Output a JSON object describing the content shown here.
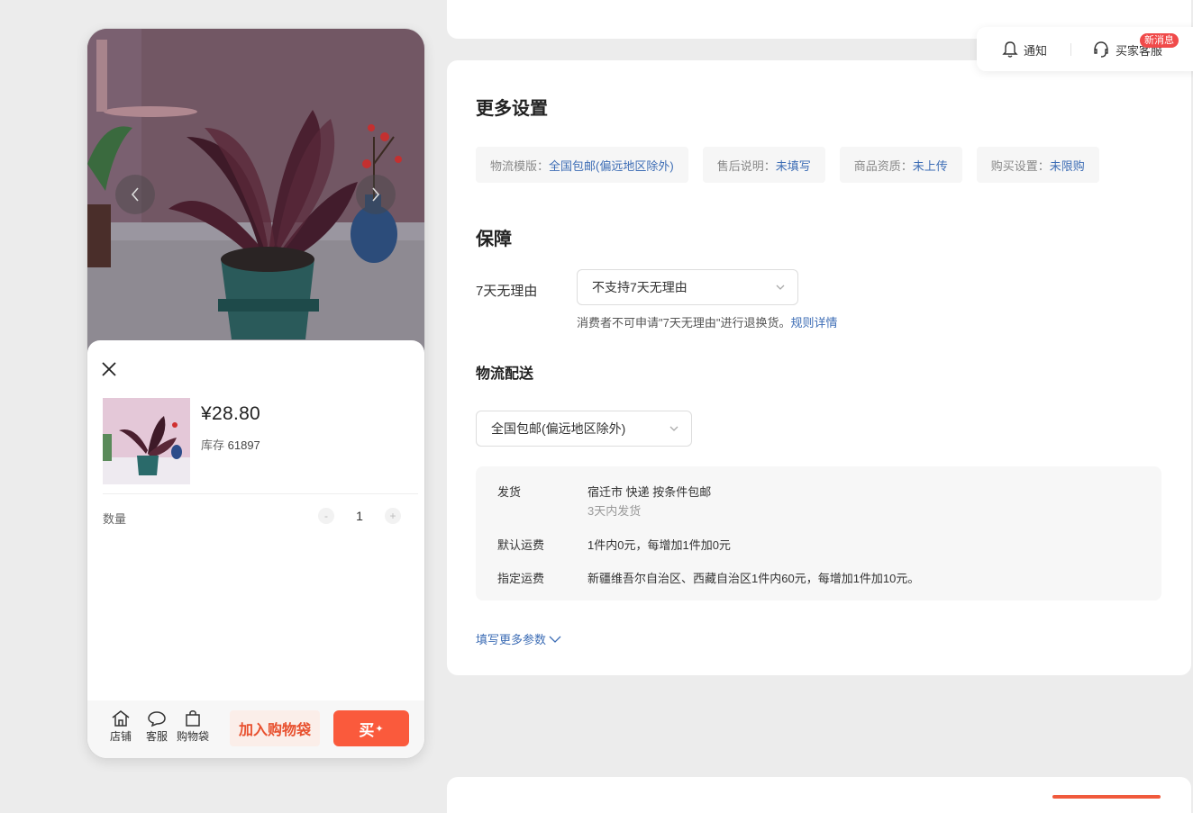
{
  "phone": {
    "price": "¥28.80",
    "stock_label": "库存",
    "stock_value": "61897",
    "quantity_label": "数量",
    "quantity_value": "1",
    "minus_label": "-",
    "plus_label": "+",
    "bottom": {
      "store_label": "店铺",
      "service_label": "客服",
      "bag_label": "购物袋",
      "add_cart_label": "加入购物袋",
      "buy_label": "买"
    }
  },
  "settings": {
    "more_title": "更多设置",
    "chips": [
      {
        "key": "物流模版：",
        "value": "全国包邮(偏远地区除外)"
      },
      {
        "key": "售后说明：",
        "value": "未填写"
      },
      {
        "key": "商品资质：",
        "value": "未上传"
      },
      {
        "key": "购买设置：",
        "value": "未限购"
      }
    ],
    "guarantee_title": "保障",
    "return_label": "7天无理由",
    "return_select": "不支持7天无理由",
    "return_hint": "消费者不可申请\"7天无理由\"进行退换货。",
    "return_rule_link": "规则详情",
    "logistics_title": "物流配送",
    "logistics_select": "全国包邮(偏远地区除外)",
    "shipping": {
      "ship_key": "发货",
      "ship_value": "宿迁市 快递 按条件包邮",
      "ship_sub": "3天内发货",
      "default_key": "默认运费",
      "default_value": "1件内0元，每增加1件加0元",
      "special_key": "指定运费",
      "special_value": "新疆维吾尔自治区、西藏自治区1件内60元，每增加1件加10元。"
    },
    "more_params_link": "填写更多参数"
  },
  "float_bar": {
    "notify_label": "通知",
    "service_label": "买家客服",
    "badge_label": "新消息"
  },
  "colors": {
    "accent": "#fa5a3c",
    "link": "#3d6db5",
    "badge": "#f04a4a"
  }
}
